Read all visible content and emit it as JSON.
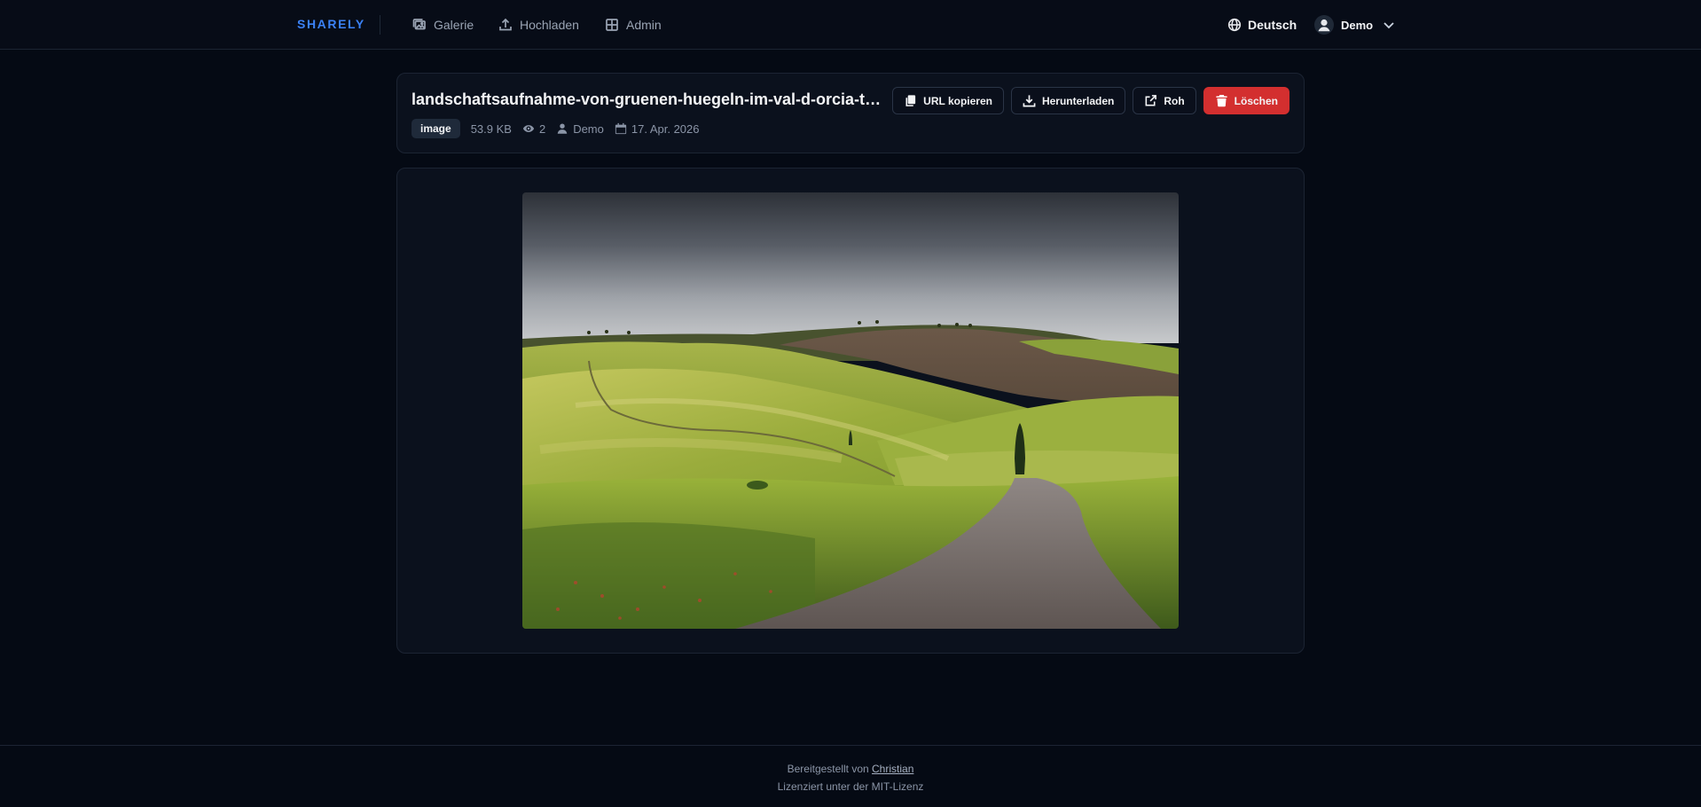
{
  "nav": {
    "brand": "SHARELY",
    "items": [
      {
        "label": "Galerie",
        "icon": "gallery-icon"
      },
      {
        "label": "Hochladen",
        "icon": "upload-icon"
      },
      {
        "label": "Admin",
        "icon": "grid-icon"
      }
    ],
    "language": "Deutsch",
    "user": "Demo"
  },
  "file": {
    "title": "landschaftsaufnahme-von-gruenen-huegeln-im-val-d-orcia-toskana.jpg",
    "type_badge": "image",
    "size": "53.9 KB",
    "views": "2",
    "owner": "Demo",
    "date": "17. Apr. 2026"
  },
  "actions": {
    "copy_url": "URL kopieren",
    "download": "Herunterladen",
    "raw": "Roh",
    "delete": "Löschen"
  },
  "footer": {
    "provided_by": "Bereitgestellt von",
    "author": "Christian",
    "license": "Lizenziert unter der MIT-Lizenz"
  },
  "colors": {
    "background": "#050a14",
    "card": "#0b111d",
    "brand": "#3b82f6",
    "danger": "#d32f2f"
  }
}
